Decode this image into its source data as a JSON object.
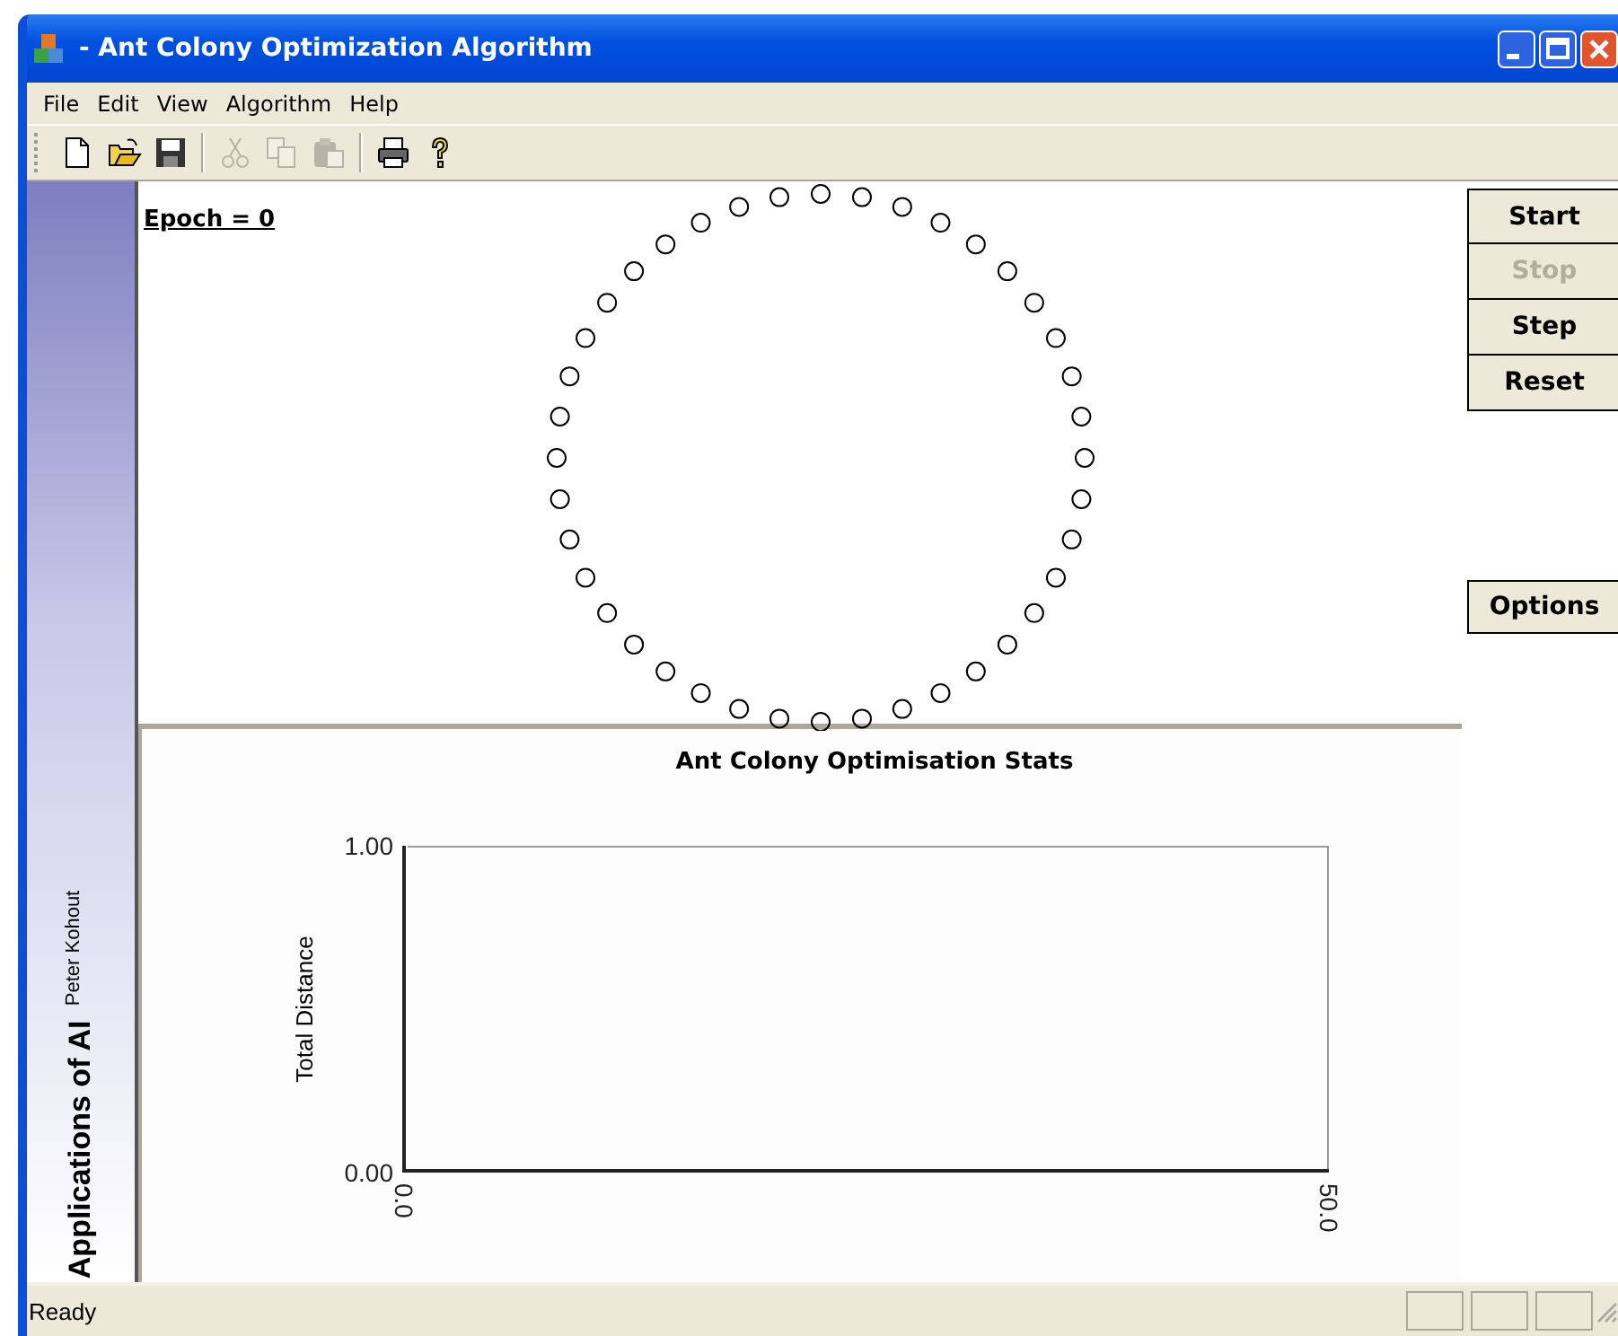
{
  "window": {
    "title": "- Ant Colony Optimization Algorithm"
  },
  "menu": [
    "File",
    "Edit",
    "View",
    "Algorithm",
    "Help"
  ],
  "toolbar": [
    {
      "kind": "new",
      "disabled": false
    },
    {
      "kind": "open",
      "disabled": false
    },
    {
      "kind": "save",
      "disabled": false
    },
    {
      "kind": "separator"
    },
    {
      "kind": "cut",
      "disabled": true
    },
    {
      "kind": "copy",
      "disabled": true
    },
    {
      "kind": "paste",
      "disabled": true
    },
    {
      "kind": "separator"
    },
    {
      "kind": "print",
      "disabled": false
    },
    {
      "kind": "help",
      "disabled": false
    }
  ],
  "sidebar": {
    "title": "Applications of AI",
    "author": "Peter Kohout"
  },
  "canvas": {
    "epoch": "Epoch = 0"
  },
  "controls": [
    {
      "label": "Start",
      "disabled": false
    },
    {
      "label": "Stop",
      "disabled": true
    },
    {
      "label": "Step",
      "disabled": false
    },
    {
      "label": "Reset",
      "disabled": false
    }
  ],
  "options_button": "Options",
  "chart": {
    "chart_data": {
      "type": "line",
      "title": "Ant Colony Optimisation Stats",
      "ylabel": "Total Distance",
      "xlim": [
        0,
        50
      ],
      "ylim": [
        0,
        1
      ],
      "xticks": [
        {
          "value": 0,
          "label": "0.0"
        },
        {
          "value": 50,
          "label": "50.0"
        }
      ],
      "yticks": [
        {
          "value": 0,
          "label": "0.00"
        },
        {
          "value": 1,
          "label": "1.00"
        }
      ]
    }
  },
  "status_bar": {
    "text": "Ready"
  }
}
